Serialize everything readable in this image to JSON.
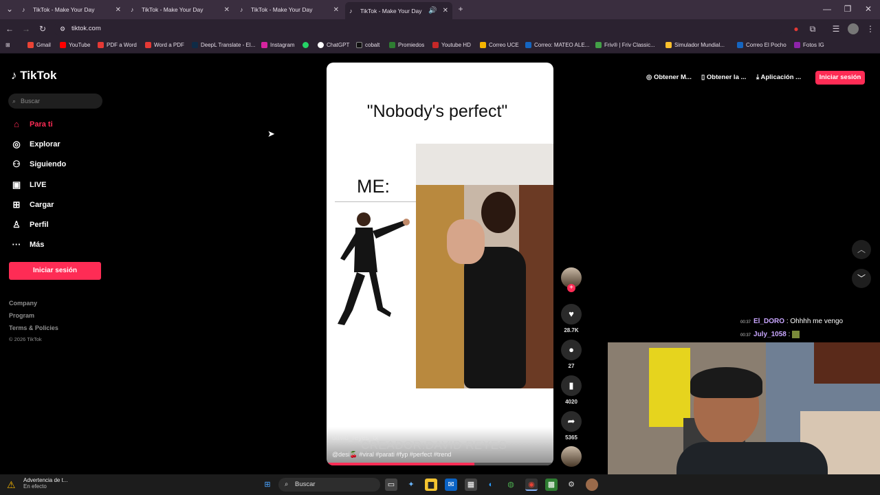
{
  "browser": {
    "tabs": [
      {
        "title": "TikTok - Make Your Day",
        "active": false
      },
      {
        "title": "TikTok - Make Your Day",
        "active": false
      },
      {
        "title": "TikTok - Make Your Day",
        "active": false
      },
      {
        "title": "TikTok - Make Your Day",
        "active": true
      }
    ],
    "url": "tiktok.com",
    "bookmarks": [
      {
        "label": "Gmail",
        "color": "#ea4335"
      },
      {
        "label": "YouTube",
        "color": "#ff0000"
      },
      {
        "label": "PDF a Word",
        "color": "#e53935"
      },
      {
        "label": "Word a PDF",
        "color": "#e53935"
      },
      {
        "label": "DeepL Translate - El...",
        "color": "#0f2b46"
      },
      {
        "label": "Instagram",
        "color": "#d6249f"
      },
      {
        "label": "",
        "color": "#25d366"
      },
      {
        "label": "ChatGPT",
        "color": "#ffffff"
      },
      {
        "label": "cobalt",
        "color": "#111111"
      },
      {
        "label": "Promiedos",
        "color": "#2e7d32"
      },
      {
        "label": "Youtube HD",
        "color": "#c62828"
      },
      {
        "label": "Correo UCE",
        "color": "#f4b400"
      },
      {
        "label": "Correo: MATEO ALE...",
        "color": "#1565c0"
      },
      {
        "label": "Friv® | Friv Classic...",
        "color": "#43a047"
      },
      {
        "label": "Simulador Mundial...",
        "color": "#fbc02d"
      },
      {
        "label": "Correo El Pocho",
        "color": "#1565c0"
      },
      {
        "label": "Fotos IG",
        "color": "#8e24aa"
      }
    ]
  },
  "tiktok": {
    "logo": "TikTok",
    "search_placeholder": "Buscar",
    "nav": [
      {
        "label": "Para ti",
        "icon": "home-icon",
        "active": true
      },
      {
        "label": "Explorar",
        "icon": "compass-icon",
        "active": false
      },
      {
        "label": "Siguiendo",
        "icon": "following-icon",
        "active": false
      },
      {
        "label": "LIVE",
        "icon": "live-icon",
        "active": false
      },
      {
        "label": "Cargar",
        "icon": "upload-icon",
        "active": false
      },
      {
        "label": "Perfil",
        "icon": "profile-icon",
        "active": false
      },
      {
        "label": "Más",
        "icon": "more-icon",
        "active": false
      }
    ],
    "login_label": "Iniciar sesión",
    "footer": [
      "Company",
      "Program",
      "Terms & Policies"
    ],
    "copyright": "© 2026 TikTok",
    "top_links": [
      "Obtener M...",
      "Obtener la ...",
      "Aplicación ..."
    ],
    "top_login": "Iniciar sesión"
  },
  "video": {
    "caption": "\"Nobody's perfect\"",
    "me_label": "ME:",
    "author_overlay": "david_reyes_tx",
    "credit_watermark": "CREADOR:DAVID REYES",
    "tags": "@desi🍒 #viral #parati #fyp #perfect #trend",
    "progress": 0.65
  },
  "actions": {
    "likes": "28.7K",
    "comments": "27",
    "saves": "4020",
    "shares": "5365"
  },
  "chat": [
    {
      "time": "00:37",
      "user": "El_DORO",
      "message": ": Ohhhh me vengo"
    },
    {
      "time": "00:37",
      "user": "July_1058",
      "message": ":"
    }
  ],
  "taskbar": {
    "warning_title": "Advertencia de t...",
    "warning_sub": "En efecto",
    "search_label": "Buscar"
  }
}
